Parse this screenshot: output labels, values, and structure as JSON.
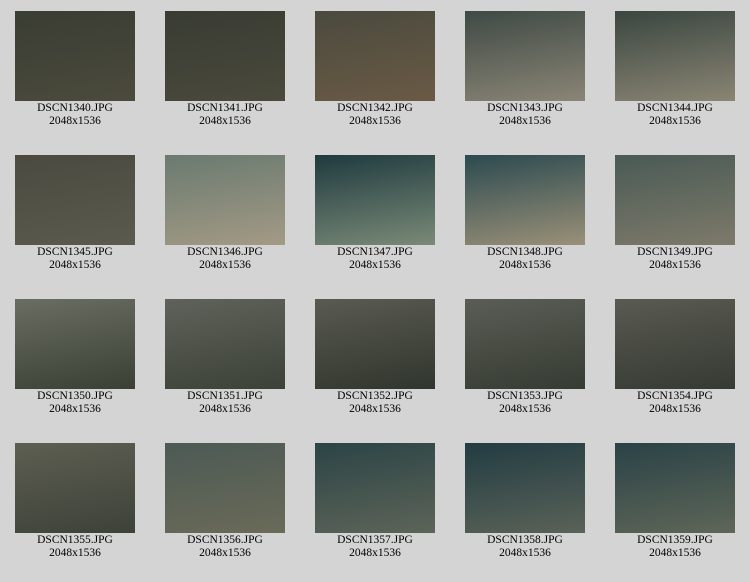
{
  "thumbnails": [
    {
      "name": "DSCN1340.JPG",
      "size": "2048x1536",
      "c1": "#3a3d33",
      "c2": "#4b4a3d"
    },
    {
      "name": "DSCN1341.JPG",
      "size": "2048x1536",
      "c1": "#393c33",
      "c2": "#4a493c"
    },
    {
      "name": "DSCN1342.JPG",
      "size": "2048x1536",
      "c1": "#4a4a3e",
      "c2": "#6a5a45"
    },
    {
      "name": "DSCN1343.JPG",
      "size": "2048x1536",
      "c1": "#3f4a45",
      "c2": "#8a8576"
    },
    {
      "name": "DSCN1344.JPG",
      "size": "2048x1536",
      "c1": "#3a4640",
      "c2": "#8a8574"
    },
    {
      "name": "DSCN1345.JPG",
      "size": "2048x1536",
      "c1": "#4a4a40",
      "c2": "#5b5a4e"
    },
    {
      "name": "DSCN1346.JPG",
      "size": "2048x1536",
      "c1": "#6a7a70",
      "c2": "#a39a85"
    },
    {
      "name": "DSCN1347.JPG",
      "size": "2048x1536",
      "c1": "#1f3a3e",
      "c2": "#7a8a78"
    },
    {
      "name": "DSCN1348.JPG",
      "size": "2048x1536",
      "c1": "#2c4a50",
      "c2": "#9a9078"
    },
    {
      "name": "DSCN1349.JPG",
      "size": "2048x1536",
      "c1": "#4a5a55",
      "c2": "#7d7a6a"
    },
    {
      "name": "DSCN1350.JPG",
      "size": "2048x1536",
      "c1": "#6a6e62",
      "c2": "#3a4034"
    },
    {
      "name": "DSCN1351.JPG",
      "size": "2048x1536",
      "c1": "#5f625a",
      "c2": "#3c4238"
    },
    {
      "name": "DSCN1352.JPG",
      "size": "2048x1536",
      "c1": "#5a5a50",
      "c2": "#30362e"
    },
    {
      "name": "DSCN1353.JPG",
      "size": "2048x1536",
      "c1": "#5a5d55",
      "c2": "#363c33"
    },
    {
      "name": "DSCN1354.JPG",
      "size": "2048x1536",
      "c1": "#5a5a52",
      "c2": "#353a32"
    },
    {
      "name": "DSCN1355.JPG",
      "size": "2048x1536",
      "c1": "#5e5e52",
      "c2": "#3d4238"
    },
    {
      "name": "DSCN1356.JPG",
      "size": "2048x1536",
      "c1": "#4c5a55",
      "c2": "#6a6a58"
    },
    {
      "name": "DSCN1357.JPG",
      "size": "2048x1536",
      "c1": "#2c4446",
      "c2": "#5c6458"
    },
    {
      "name": "DSCN1358.JPG",
      "size": "2048x1536",
      "c1": "#223c42",
      "c2": "#5a6258"
    },
    {
      "name": "DSCN1359.JPG",
      "size": "2048x1536",
      "c1": "#2a4246",
      "c2": "#5e6658"
    }
  ]
}
